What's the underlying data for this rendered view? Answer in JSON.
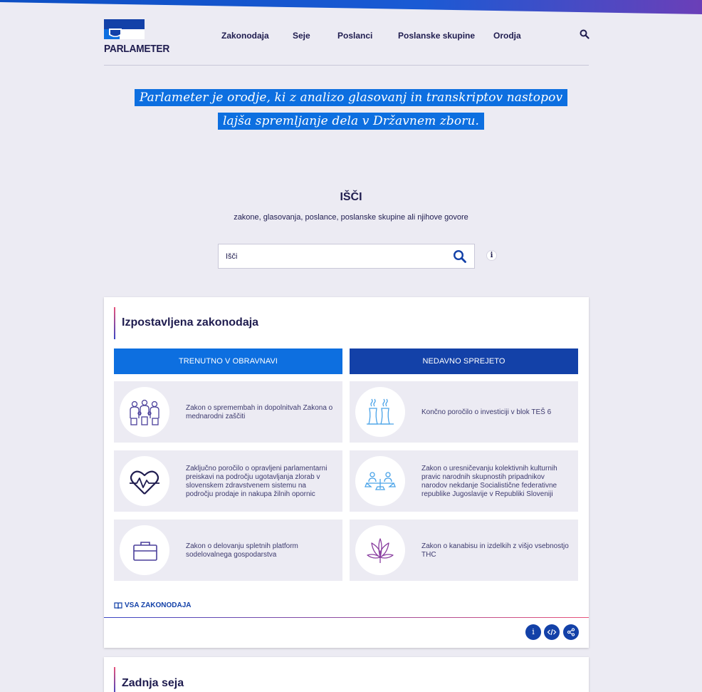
{
  "brand": {
    "name": "PARLAMETER"
  },
  "nav": {
    "items": [
      {
        "label": "Zakonodaja"
      },
      {
        "label": "Seje"
      },
      {
        "label": "Poslanci"
      },
      {
        "label": "Poslanske skupine"
      },
      {
        "label": "Orodja"
      }
    ]
  },
  "hero": {
    "line1": "Parlameter je orodje, ki z analizo glasovanj in transkriptov nastopov",
    "line2": "lajša spremljanje dela v Državnem zboru."
  },
  "search": {
    "title": "IŠČI",
    "subtitle": "zakone, glasovanja, poslance, poslanske skupine ali njihove govore",
    "placeholder": "Išči",
    "info": "i"
  },
  "legislation_card": {
    "title": "Izpostavljena zakonodaja",
    "tabs": [
      {
        "label": "TRENUTNO V OBRAVNAVI"
      },
      {
        "label": "NEDAVNO SPREJETO"
      }
    ],
    "items": [
      {
        "text": "Zakon o spremembah in dopolnitvah Zakona o mednarodni zaščiti",
        "icon": "family-icon"
      },
      {
        "text": "Končno poročilo o investiciji v blok TEŠ 6",
        "icon": "power-plant-icon"
      },
      {
        "text": "Zaključno poročilo o opravljeni parlamentarni preiskavi na področju ugotavljanja zlorab v slovenskem zdravstvenem sistemu na področju prodaje in nakupa žilnih opornic",
        "icon": "heart-pulse-icon"
      },
      {
        "text": "Zakon o uresničevanju kolektivnih kulturnih pravic narodnih skupnostih pripadnikov narodov nekdanje Socialistične federativne republike Jugoslavije v Republiki Sloveniji",
        "icon": "people-scale-icon"
      },
      {
        "text": "Zakon o delovanju spletnih platform sodelovalnega gospodarstva",
        "icon": "briefcase-icon"
      },
      {
        "text": "Zakon o kanabisu in izdelkih z višjo vsebnostjo THC",
        "icon": "cannabis-leaf-icon"
      }
    ],
    "all_link": "VSA ZAKONODAJA",
    "actions": {
      "info": "i"
    }
  },
  "session_card": {
    "title": "Zadnja seja"
  },
  "colors": {
    "background": "#ecebf3",
    "primary_blue": "#0d6fe0",
    "dark_blue": "#1341a8",
    "text_dark": "#1f1c4f",
    "accent_pink": "#e8527a"
  }
}
